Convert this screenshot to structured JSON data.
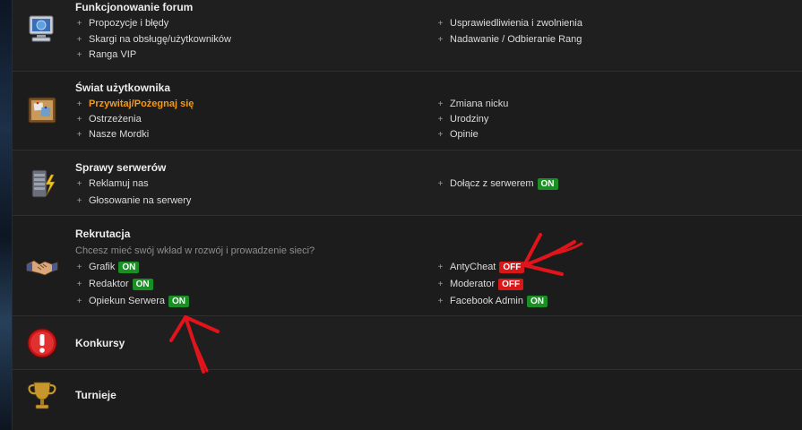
{
  "forums": [
    {
      "title": "Funkcjonowanie forum",
      "icon": "computer-globe-icon",
      "subforums_left": [
        "Propozycje i błędy",
        "Skargi na obsługę/użytkowników",
        "Ranga VIP"
      ],
      "subforums_right": [
        "Usprawiedliwienia i zwolnienia",
        "Nadawanie / Odbieranie Rang"
      ]
    },
    {
      "title": "Świat użytkownika",
      "icon": "corkboard-icon",
      "subforums_left": [
        "Przywitaj/Pożegnaj się",
        "Ostrzeżenia",
        "Nasze Mordki"
      ],
      "subforums_right": [
        "Zmiana nicku",
        "Urodziny",
        "Opinie"
      ]
    },
    {
      "title": "Sprawy serwerów",
      "icon": "server-lightning-icon",
      "subforums_left": [
        "Reklamuj nas",
        "Głosowanie na serwery"
      ],
      "subforums_right": [
        "Dołącz z serwerem"
      ],
      "badges": {
        "right_0": "ON"
      }
    },
    {
      "title": "Rekrutacja",
      "icon": "handshake-icon",
      "description": "Chcesz mieć swój wkład w rozwój i prowadzenie sieci?",
      "subforums_left": [
        "Grafik",
        "Redaktor",
        "Opiekun Serwera"
      ],
      "subforums_right": [
        "AntyCheat",
        "Moderator",
        "Facebook Admin"
      ],
      "badges": {
        "left_0": "ON",
        "left_1": "ON",
        "left_2": "ON",
        "right_0": "OFF",
        "right_1": "OFF",
        "right_2": "ON"
      }
    },
    {
      "title": "Konkursy",
      "icon": "exclamation-icon"
    },
    {
      "title": "Turnieje",
      "icon": "trophy-icon"
    }
  ],
  "colors": {
    "on": "#1a8f24",
    "off": "#d81818",
    "highlight": "#f29a1a",
    "annotation": "#e0141a"
  }
}
